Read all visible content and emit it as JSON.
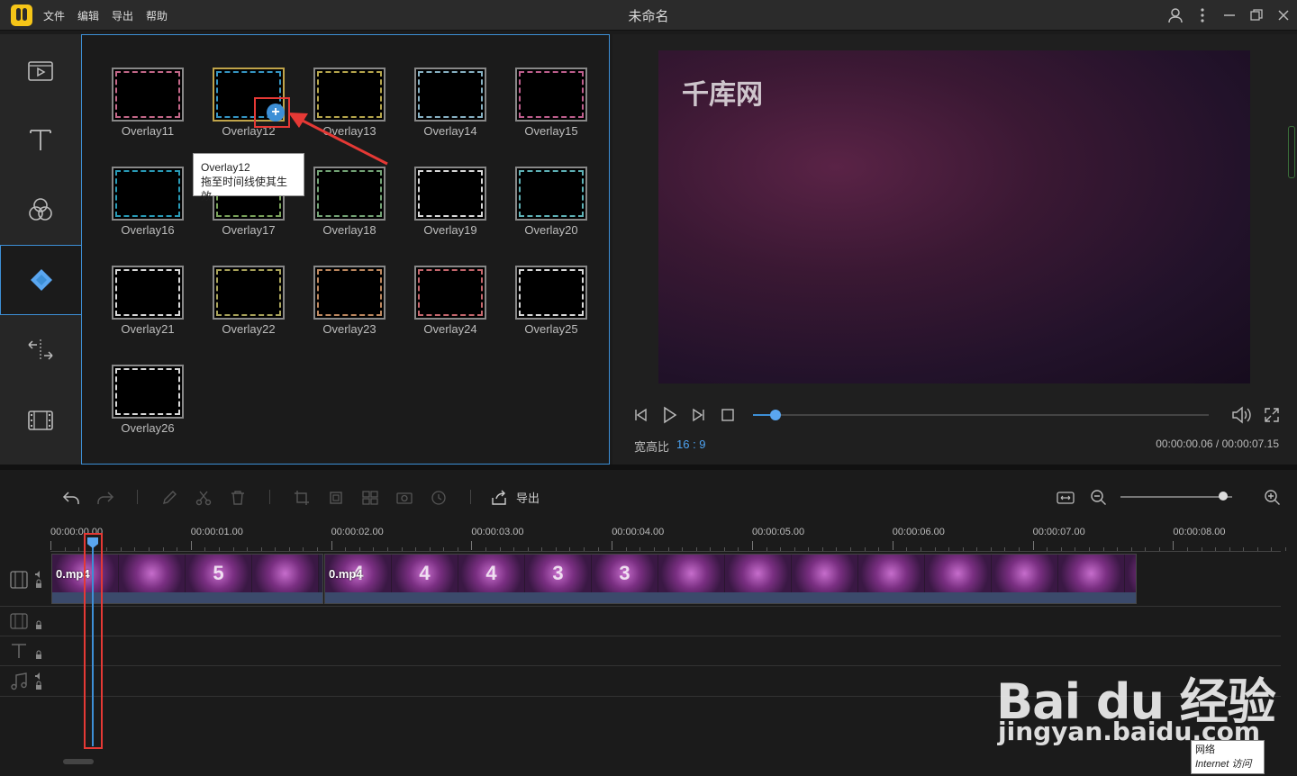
{
  "window": {
    "title": "未命名",
    "menu": [
      "文件",
      "编辑",
      "导出",
      "帮助"
    ]
  },
  "rail": {
    "items": [
      "media-icon",
      "text-icon",
      "filter-icon",
      "overlay-icon",
      "transition-icon",
      "film-icon"
    ],
    "active_index": 3
  },
  "library": {
    "overlays": [
      {
        "name": "Overlay11",
        "color": "#e57aa0"
      },
      {
        "name": "Overlay12",
        "color": "#3fb0e6"
      },
      {
        "name": "Overlay13",
        "color": "#d6c35a"
      },
      {
        "name": "Overlay14",
        "color": "#9fd0e6"
      },
      {
        "name": "Overlay15",
        "color": "#e06fa6"
      },
      {
        "name": "Overlay16",
        "color": "#2fb6d6"
      },
      {
        "name": "Overlay17",
        "color": "#8fbf6a"
      },
      {
        "name": "Overlay18",
        "color": "#88c08a"
      },
      {
        "name": "Overlay19",
        "color": "#ffffff"
      },
      {
        "name": "Overlay20",
        "color": "#6fd0d6"
      },
      {
        "name": "Overlay21",
        "color": "#ffffff"
      },
      {
        "name": "Overlay22",
        "color": "#c7c06a"
      },
      {
        "name": "Overlay23",
        "color": "#e0a070"
      },
      {
        "name": "Overlay24",
        "color": "#e87a80"
      },
      {
        "name": "Overlay25",
        "color": "#ffffff"
      },
      {
        "name": "Overlay26",
        "color": "#ffffff"
      }
    ],
    "tooltip": {
      "title": "Overlay12",
      "hint": "拖至时间线使其生效"
    },
    "add_symbol": "+"
  },
  "preview": {
    "watermark": "千库网",
    "aspect_label": "宽高比",
    "aspect_value": "16 : 9",
    "timecode": "00:00:00.06 / 00:00:07.15",
    "progress": 0.01
  },
  "toolbar": {
    "export_label": "导出",
    "zoom_level": 0.92
  },
  "timeline": {
    "ruler": [
      "00:00:00.00",
      "00:00:01.00",
      "00:00:02.00",
      "00:00:03.00",
      "00:00:04.00",
      "00:00:05.00",
      "00:00:06.00",
      "00:00:07.00",
      "00:00:08.00"
    ],
    "clips": [
      {
        "name": "0.mp4",
        "frames": [
          "",
          "",
          "5",
          ""
        ]
      },
      {
        "name": "0.mp4",
        "frames": [
          "4",
          "4",
          "4",
          "3",
          "3",
          "",
          "",
          "",
          "",
          "",
          "",
          "",
          ""
        ]
      }
    ]
  },
  "overlay_text": {
    "baidu": "Bai du 经验",
    "baidu_sub": "jingyan.baidu.com",
    "network_title": "网络",
    "network_sub": "Internet 访问"
  },
  "colors": {
    "accent": "#3d8fd6",
    "highlight": "#e53935"
  }
}
